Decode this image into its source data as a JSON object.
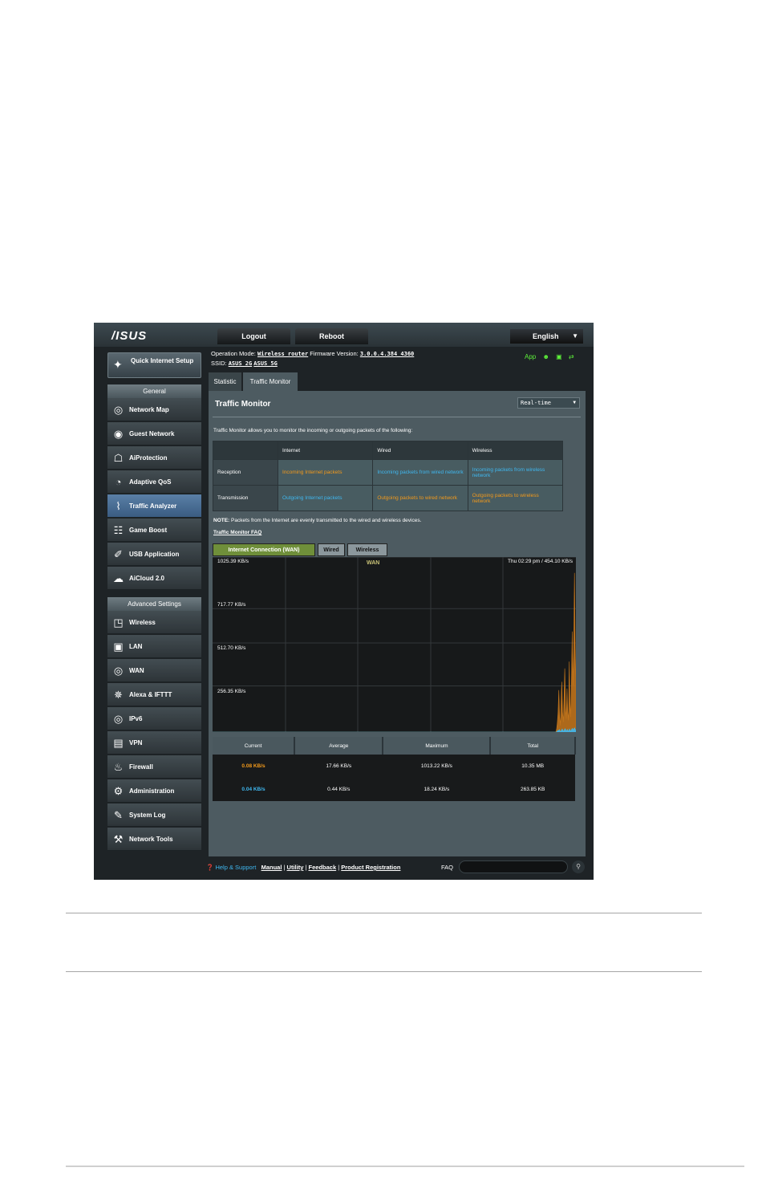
{
  "header": {
    "logo": "/ISUS",
    "logout": "Logout",
    "reboot": "Reboot",
    "language": "English"
  },
  "info": {
    "op_mode_label": "Operation Mode:",
    "op_mode": "Wireless router",
    "fw_label": "Firmware Version:",
    "fw": "3.0.0.4.384_4360",
    "ssid_label": "SSID:",
    "ssid_2g": "ASUS_2G",
    "ssid_5g": "ASUS_5G",
    "app": "App"
  },
  "sidebar": {
    "qis": "Quick Internet Setup",
    "general": "General",
    "general_items": [
      {
        "label": "Network Map",
        "icon": "globe-icon"
      },
      {
        "label": "Guest Network",
        "icon": "guest-globe-icon"
      },
      {
        "label": "AiProtection",
        "icon": "shield-icon"
      },
      {
        "label": "Adaptive QoS",
        "icon": "gauge-icon"
      },
      {
        "label": "Traffic Analyzer",
        "icon": "pulse-icon"
      },
      {
        "label": "Game Boost",
        "icon": "gamepad-icon"
      },
      {
        "label": "USB Application",
        "icon": "usb-icon"
      },
      {
        "label": "AiCloud 2.0",
        "icon": "cloud-icon"
      }
    ],
    "advanced": "Advanced Settings",
    "advanced_items": [
      {
        "label": "Wireless",
        "icon": "wifi-icon"
      },
      {
        "label": "LAN",
        "icon": "monitor-icon"
      },
      {
        "label": "WAN",
        "icon": "globe-icon"
      },
      {
        "label": "Alexa & IFTTT",
        "icon": "alexa-icon"
      },
      {
        "label": "IPv6",
        "icon": "ipv6-icon"
      },
      {
        "label": "VPN",
        "icon": "vpn-icon"
      },
      {
        "label": "Firewall",
        "icon": "flame-icon"
      },
      {
        "label": "Administration",
        "icon": "gear-icon"
      },
      {
        "label": "System Log",
        "icon": "log-icon"
      },
      {
        "label": "Network Tools",
        "icon": "tools-icon"
      }
    ]
  },
  "tabs": [
    "Statistic",
    "Traffic Monitor"
  ],
  "panel": {
    "title": "Traffic Monitor",
    "mode": "Real-time",
    "description": "Traffic Monitor allows you to monitor the incoming or outgoing packets of the following:",
    "table": {
      "headers": [
        "",
        "Internet",
        "Wired",
        "Wireless"
      ],
      "rows": [
        {
          "label": "Reception",
          "internet": "Incoming Internet packets",
          "wired": "Incoming packets from wired network",
          "wireless": "Incoming packets from wireless network"
        },
        {
          "label": "Transmission",
          "internet": "Outgoing Internet packets",
          "wired": "Outgoing packets to wired network",
          "wireless": "Outgoing packets to wireless network"
        }
      ]
    },
    "note_bold": "NOTE:",
    "note": "Packets from the Internet are evenly transmitted to the wired and wireless devices.",
    "faq_link": "Traffic Monitor FAQ",
    "graph_tabs": [
      "Internet Connection (WAN)",
      "Wired",
      "Wireless"
    ]
  },
  "chart_data": {
    "type": "area",
    "title": "WAN",
    "timestamp": "Thu 02:29 pm / 454.10 KB/s",
    "y_ticks": [
      "1025.39 KB/s",
      "717.77 KB/s",
      "512.70 KB/s",
      "256.35 KB/s"
    ],
    "series": [
      {
        "name": "WAN",
        "color": "#c8781c",
        "values": [
          0,
          0,
          0,
          0,
          0,
          0,
          0,
          0,
          0,
          0,
          0,
          0,
          0,
          0,
          0,
          0,
          0,
          0,
          0,
          0,
          0,
          0,
          0,
          0,
          0,
          0,
          0,
          0,
          0,
          0,
          0,
          0,
          0,
          0,
          0,
          0,
          0,
          0,
          0,
          0,
          0,
          0,
          0,
          0,
          0,
          0,
          0,
          0,
          0,
          0,
          0,
          0,
          0,
          0,
          0,
          0,
          0,
          0,
          0,
          0,
          0,
          0,
          0,
          0,
          0,
          0,
          0,
          0,
          0,
          0,
          0,
          0,
          0,
          0,
          0,
          0,
          0,
          0,
          0,
          0,
          0,
          0,
          0,
          0,
          0,
          0,
          0,
          0,
          0,
          0,
          0,
          0,
          0,
          0,
          0,
          0,
          0,
          0,
          0,
          0,
          0,
          0,
          0,
          0,
          0,
          0,
          0,
          0,
          0,
          0,
          0,
          0,
          0,
          0,
          0,
          0,
          0,
          0,
          0,
          0,
          0,
          0,
          0,
          0,
          0,
          0,
          0,
          0,
          0,
          0,
          0,
          0,
          0,
          0,
          0,
          0,
          0,
          0,
          0,
          0,
          0,
          0,
          0,
          0,
          0,
          0,
          0,
          0,
          0,
          0,
          0,
          0,
          0,
          0,
          0,
          0,
          0,
          0,
          0,
          0,
          0,
          0,
          0,
          0,
          0,
          0,
          0,
          0,
          0,
          0,
          0,
          0,
          0,
          0,
          0,
          0,
          0,
          0,
          0,
          0,
          0,
          0,
          0,
          0,
          0,
          0,
          0,
          0,
          0,
          0,
          0,
          0,
          0,
          0,
          0,
          0,
          0,
          0,
          0,
          0,
          0,
          0,
          0,
          0,
          0,
          0,
          0,
          0,
          0,
          0,
          0,
          0,
          0,
          0,
          0,
          0,
          0,
          0,
          0,
          0,
          0,
          0,
          0,
          0,
          0,
          0,
          0,
          0,
          0,
          0,
          0,
          0,
          0,
          0,
          0,
          0,
          0,
          0,
          0,
          0,
          0,
          0,
          0,
          0,
          0,
          0,
          0,
          0,
          0,
          0,
          0,
          0,
          0,
          0,
          0,
          0,
          0,
          0,
          0,
          0,
          0,
          0,
          0,
          0,
          0,
          0,
          0,
          0,
          0,
          0,
          0,
          0,
          0,
          0,
          0,
          0,
          0,
          0,
          0,
          0,
          0,
          0,
          0,
          0,
          0,
          0,
          0,
          0,
          0,
          0,
          0,
          0,
          0,
          0,
          0,
          0,
          0,
          0,
          0,
          0,
          0,
          0,
          0,
          0,
          0,
          0,
          0,
          0,
          0,
          0,
          0,
          0,
          0,
          0,
          0,
          0,
          0,
          0,
          0,
          0,
          0,
          0,
          0,
          0,
          0,
          0,
          0,
          0,
          0,
          0,
          0,
          0,
          0,
          0,
          0,
          0,
          0,
          0,
          0,
          0,
          0,
          0,
          0,
          0,
          0,
          0,
          0,
          0,
          0,
          0,
          0,
          0,
          0,
          0,
          0,
          0,
          0,
          0,
          0,
          0,
          0,
          0,
          0,
          0,
          0,
          0,
          0,
          0,
          0,
          0,
          0,
          0,
          0,
          0,
          0,
          0,
          0,
          0,
          0,
          0,
          0,
          0,
          0,
          0,
          0,
          0,
          0,
          0,
          0,
          0,
          0,
          0,
          0,
          0,
          0,
          0,
          0,
          0,
          0,
          0,
          0,
          0,
          0,
          0,
          0,
          0,
          0,
          0,
          0,
          0,
          0,
          0,
          0,
          0,
          0,
          0,
          0,
          0,
          0,
          0,
          0,
          0,
          0,
          0,
          0,
          0,
          0,
          0,
          0,
          0,
          0,
          0,
          0,
          0,
          0,
          0,
          0,
          0,
          0,
          0,
          0,
          0,
          0,
          0,
          0,
          0,
          0,
          0,
          0,
          0,
          0,
          0,
          0,
          0,
          0,
          0,
          0,
          0,
          0,
          0,
          0,
          0,
          0,
          0,
          20,
          60,
          120,
          250,
          90,
          40,
          180,
          300,
          120,
          60,
          200,
          380,
          150,
          80,
          260,
          120,
          70,
          420,
          180,
          90,
          340,
          600,
          280,
          480,
          950,
          520,
          300
        ]
      },
      {
        "name": "WAN-tx",
        "color": "#3fb8f0",
        "values": [
          0,
          0,
          0,
          0,
          0,
          0,
          0,
          0,
          0,
          0,
          0,
          0,
          0,
          0,
          0,
          0,
          0,
          0,
          0,
          0,
          0,
          0,
          0,
          0,
          0,
          0,
          0,
          0,
          0,
          0,
          0,
          0,
          0,
          0,
          0,
          0,
          0,
          0,
          0,
          0,
          0,
          0,
          0,
          0,
          0,
          0,
          0,
          0,
          0,
          0,
          0,
          0,
          0,
          0,
          0,
          0,
          0,
          0,
          0,
          0,
          0,
          0,
          0,
          0,
          0,
          0,
          0,
          0,
          0,
          0,
          0,
          0,
          0,
          0,
          0,
          0,
          0,
          0,
          0,
          0,
          0,
          0,
          0,
          0,
          0,
          0,
          0,
          0,
          0,
          0,
          0,
          0,
          0,
          0,
          0,
          0,
          0,
          0,
          0,
          0,
          0,
          0,
          0,
          0,
          0,
          0,
          0,
          0,
          0,
          0,
          0,
          0,
          0,
          0,
          0,
          0,
          0,
          0,
          0,
          0,
          0,
          0,
          0,
          0,
          0,
          0,
          0,
          0,
          0,
          0,
          0,
          0,
          0,
          0,
          0,
          0,
          0,
          0,
          0,
          0,
          0,
          0,
          0,
          0,
          0,
          0,
          0,
          0,
          0,
          0,
          0,
          0,
          0,
          0,
          0,
          0,
          0,
          0,
          0,
          0,
          0,
          0,
          0,
          0,
          0,
          0,
          0,
          0,
          0,
          0,
          0,
          0,
          0,
          0,
          0,
          0,
          0,
          0,
          0,
          0,
          0,
          0,
          0,
          0,
          0,
          0,
          0,
          0,
          0,
          0,
          0,
          0,
          0,
          0,
          0,
          0,
          0,
          0,
          0,
          0,
          0,
          0,
          0,
          0,
          0,
          0,
          0,
          0,
          0,
          0,
          0,
          0,
          0,
          0,
          0,
          0,
          0,
          0,
          0,
          0,
          0,
          0,
          0,
          0,
          0,
          0,
          0,
          0,
          0,
          0,
          0,
          0,
          0,
          0,
          0,
          0,
          0,
          0,
          0,
          0,
          0,
          0,
          0,
          0,
          0,
          0,
          0,
          0,
          0,
          0,
          0,
          0,
          0,
          0,
          0,
          0,
          0,
          0,
          0,
          0,
          0,
          0,
          0,
          0,
          0,
          0,
          0,
          0,
          0,
          0,
          0,
          0,
          0,
          0,
          0,
          0,
          0,
          0,
          0,
          0,
          0,
          0,
          0,
          0,
          0,
          0,
          0,
          0,
          0,
          0,
          0,
          0,
          0,
          0,
          0,
          0,
          0,
          0,
          0,
          0,
          0,
          0,
          0,
          0,
          0,
          0,
          0,
          0,
          0,
          0,
          0,
          0,
          0,
          0,
          0,
          0,
          0,
          0,
          0,
          0,
          0,
          0,
          0,
          0,
          0,
          0,
          0,
          0,
          0,
          0,
          0,
          0,
          0,
          0,
          0,
          0,
          0,
          0,
          0,
          0,
          0,
          0,
          0,
          0,
          0,
          0,
          0,
          0,
          0,
          0,
          0,
          0,
          0,
          0,
          0,
          0,
          0,
          0,
          0,
          0,
          0,
          0,
          0,
          0,
          0,
          0,
          0,
          0,
          0,
          0,
          0,
          0,
          0,
          0,
          0,
          0,
          0,
          0,
          0,
          0,
          0,
          0,
          0,
          0,
          0,
          0,
          0,
          0,
          0,
          0,
          0,
          0,
          0,
          0,
          0,
          0,
          0,
          0,
          0,
          0,
          0,
          0,
          0,
          0,
          0,
          0,
          0,
          0,
          0,
          0,
          0,
          0,
          0,
          0,
          0,
          0,
          0,
          0,
          0,
          0,
          0,
          0,
          0,
          0,
          0,
          0,
          0,
          0,
          0,
          0,
          0,
          0,
          0,
          0,
          0,
          0,
          0,
          0,
          0,
          0,
          0,
          0,
          0,
          0,
          0,
          0,
          0,
          0,
          0,
          0,
          0,
          0,
          0,
          0,
          0,
          0,
          0,
          0,
          0,
          0,
          0,
          0,
          0,
          0,
          0,
          0,
          0,
          0,
          0,
          0,
          0,
          0,
          0,
          0,
          0,
          0,
          0,
          0,
          0,
          0,
          5,
          10,
          8,
          15,
          6,
          4,
          12,
          18,
          9,
          5,
          14,
          20,
          10,
          6,
          16,
          8,
          5,
          18,
          10,
          6,
          15,
          22,
          12,
          18,
          25,
          16,
          10
        ]
      }
    ],
    "ylim": [
      0,
      1025.39
    ]
  },
  "stats": {
    "headers": [
      "Current",
      "Average",
      "Maximum",
      "Total"
    ],
    "rows": [
      {
        "current": "0.08 KB/s",
        "average": "17.66 KB/s",
        "maximum": "1013.22 KB/s",
        "total": "10.35 MB",
        "color": "#f39a1b"
      },
      {
        "current": "0.04 KB/s",
        "average": "0.44 KB/s",
        "maximum": "18.24 KB/s",
        "total": "263.85 KB",
        "color": "#3fb8f0"
      }
    ]
  },
  "footer": {
    "help": "Help & Support",
    "links": [
      "Manual",
      "Utility",
      "Feedback",
      "Product Registration"
    ],
    "faq": "FAQ"
  }
}
